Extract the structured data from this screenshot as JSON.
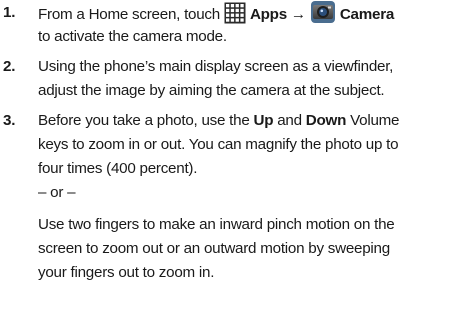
{
  "steps": [
    {
      "number": "1.",
      "line1": {
        "prefix": "From a Home screen, touch ",
        "apps_label": "Apps",
        "arrow": "→",
        "camera_label": "Camera"
      },
      "line2": "to activate the camera mode.",
      "icons": [
        "apps-grid-icon",
        "camera-icon"
      ]
    },
    {
      "number": "2.",
      "line1": "Using the phone’s main display screen as a viewfinder,",
      "line2": "adjust the image by aiming the camera at the subject."
    },
    {
      "number": "3.",
      "line1": {
        "prefix": "Before you take a photo, use the ",
        "up": "Up",
        "and": " and ",
        "down": "Down",
        "suffix": " Volume"
      },
      "line2": "keys to zoom in or out. You can magnify the photo up to",
      "line3": "four times (400 percent).",
      "or": "– or –",
      "alt_line1": "Use two fingers to make an inward pinch motion on the",
      "alt_line2": "screen to zoom out or an outward motion by sweeping",
      "alt_line3": "your fingers out to zoom in."
    }
  ]
}
